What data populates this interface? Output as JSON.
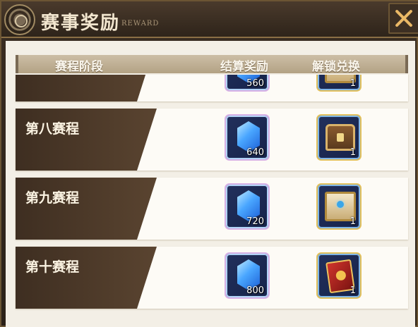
{
  "header": {
    "title": "赛事奖励",
    "subtitle": "REWARD",
    "close_label": "close"
  },
  "columns": {
    "stage": "赛程阶段",
    "settle": "结算奖励",
    "unlock": "解锁兑换"
  },
  "rows": [
    {
      "label": "",
      "settle": {
        "icon": "crystal-icon",
        "qty": "560"
      },
      "unlock": {
        "icon": "box-icon",
        "qty": "1"
      }
    },
    {
      "label": "第八赛程",
      "settle": {
        "icon": "crystal-icon",
        "qty": "640"
      },
      "unlock": {
        "icon": "chest-icon",
        "qty": "1"
      }
    },
    {
      "label": "第九赛程",
      "settle": {
        "icon": "crystal-icon",
        "qty": "720"
      },
      "unlock": {
        "icon": "box-icon",
        "qty": "1"
      }
    },
    {
      "label": "第十赛程",
      "settle": {
        "icon": "crystal-icon",
        "qty": "800"
      },
      "unlock": {
        "icon": "book-icon",
        "qty": "1"
      }
    }
  ],
  "colors": {
    "accent": "#e9b866",
    "band": "#3e2e21",
    "row_bg": "#fdfbf6"
  }
}
